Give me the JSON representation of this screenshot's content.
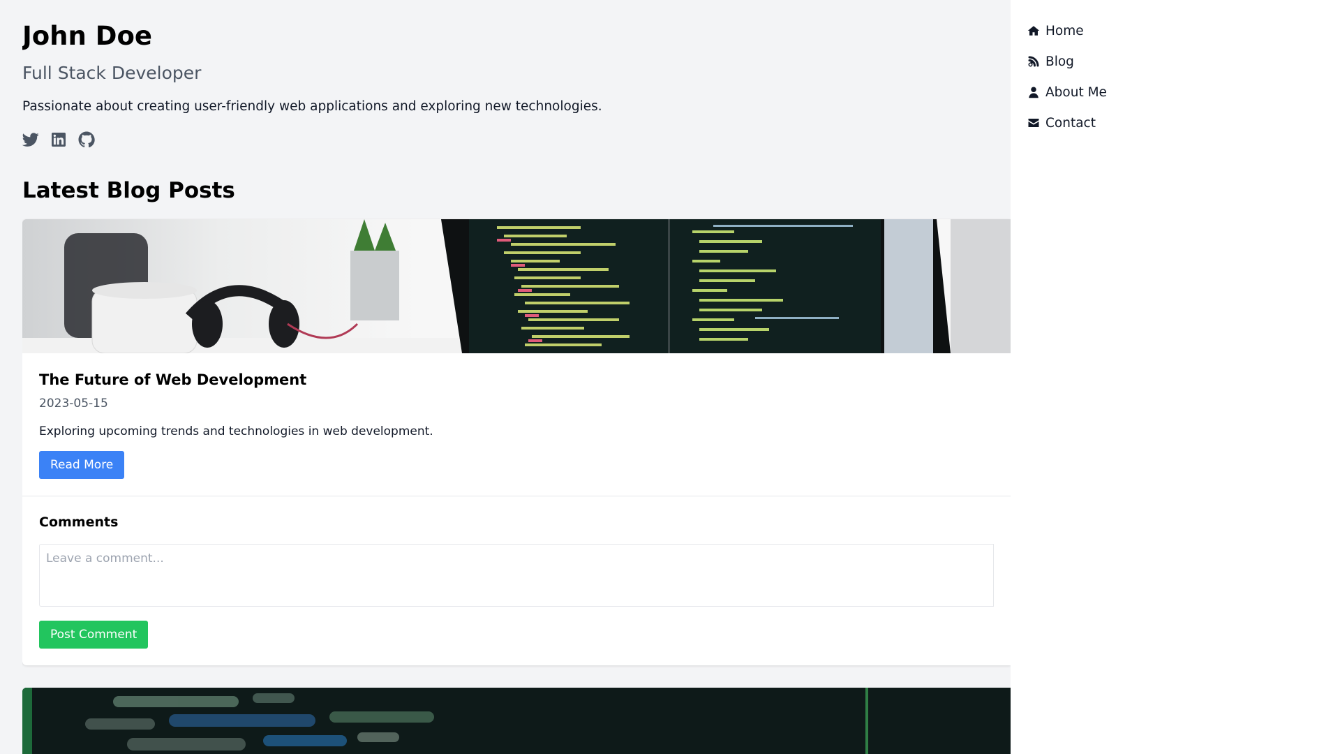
{
  "profile": {
    "name": "John Doe",
    "role": "Full Stack Developer",
    "bio": "Passionate about creating user-friendly web applications and exploring new technologies."
  },
  "socials": [
    {
      "icon": "twitter-icon"
    },
    {
      "icon": "linkedin-icon"
    },
    {
      "icon": "github-icon"
    }
  ],
  "blog": {
    "section_title": "Latest Blog Posts",
    "posts": [
      {
        "title": "The Future of Web Development",
        "date": "2023-05-15",
        "excerpt": "Exploring upcoming trends and technologies in web development.",
        "read_more_label": "Read More"
      }
    ]
  },
  "comments": {
    "title": "Comments",
    "placeholder": "Leave a comment...",
    "post_label": "Post Comment"
  },
  "nav": {
    "items": [
      {
        "label": "Home",
        "icon": "home-icon"
      },
      {
        "label": "Blog",
        "icon": "blog-icon"
      },
      {
        "label": "About Me",
        "icon": "user-icon"
      },
      {
        "label": "Contact",
        "icon": "envelope-icon"
      }
    ]
  },
  "colors": {
    "primary_button": "#3b82f6",
    "success_button": "#22c55e",
    "background": "#f3f4f6"
  }
}
